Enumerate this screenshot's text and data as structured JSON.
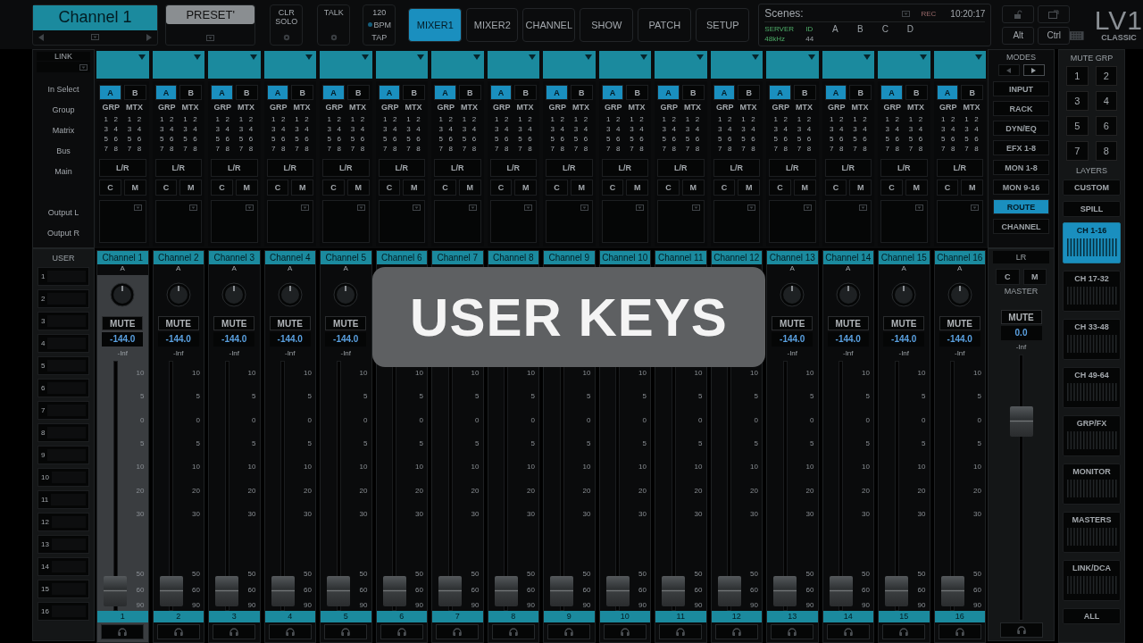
{
  "top_bar": {
    "channel_name": "Channel 1",
    "preset": "PRESET'",
    "clr_solo": "CLR SOLO",
    "talk": "TALK",
    "bpm": "120",
    "bpm_unit": "BPM",
    "tap": "TAP",
    "tabs": [
      {
        "label": "MIXER1",
        "selected": true
      },
      {
        "label": "MIXER2",
        "selected": false
      },
      {
        "label": "CHANNEL",
        "selected": false
      },
      {
        "label": "SHOW",
        "selected": false
      },
      {
        "label": "PATCH",
        "selected": false
      },
      {
        "label": "SETUP",
        "selected": false
      }
    ],
    "scenes": {
      "label": "Scenes:",
      "rec": "REC",
      "time": "10:20:17",
      "server": "SERVER",
      "server_id": "ID",
      "rate": "48kHz",
      "slots": [
        "A",
        "B",
        "C",
        "D"
      ],
      "slot_value": "44"
    },
    "alt": "Alt",
    "ctrl": "Ctrl",
    "logo": "LV1",
    "logo_sub": "CLASSIC"
  },
  "link": "LINK",
  "routing_labels": [
    "In Select",
    "Group",
    "Matrix",
    "Bus",
    "Main",
    "Output L",
    "Output R"
  ],
  "user": {
    "title": "USER",
    "keys": [
      "1",
      "2",
      "3",
      "4",
      "5",
      "6",
      "7",
      "8",
      "9",
      "10",
      "11",
      "12",
      "13",
      "14",
      "15",
      "16"
    ]
  },
  "channels": [
    {
      "name": "Channel 1",
      "selected": true,
      "in_select": [
        {
          "label": "A",
          "selected": true
        },
        {
          "label": "B",
          "selected": false
        }
      ],
      "grp": "GRP",
      "mtx": "MTX",
      "grp_keys": [
        "1",
        "2",
        "3",
        "4",
        "5",
        "6",
        "7",
        "8"
      ],
      "mtx_keys": [
        "1",
        "2",
        "3",
        "4",
        "5",
        "6",
        "7",
        "8"
      ],
      "main": "L/R",
      "c": "C",
      "m": "M",
      "input": "A",
      "mute": "MUTE",
      "gain": "-144.0",
      "meter": "-Inf",
      "scale": [
        "10",
        "5",
        "0",
        "5",
        "10",
        "20",
        "30",
        "50",
        "60",
        "90"
      ],
      "level": 0.02,
      "number": "1"
    },
    {
      "name": "Channel 2",
      "selected": false,
      "in_select": [
        {
          "label": "A",
          "selected": true
        },
        {
          "label": "B",
          "selected": false
        }
      ],
      "grp": "GRP",
      "mtx": "MTX",
      "grp_keys": [
        "1",
        "2",
        "3",
        "4",
        "5",
        "6",
        "7",
        "8"
      ],
      "mtx_keys": [
        "1",
        "2",
        "3",
        "4",
        "5",
        "6",
        "7",
        "8"
      ],
      "main": "L/R",
      "c": "C",
      "m": "M",
      "input": "A",
      "mute": "MUTE",
      "gain": "-144.0",
      "meter": "-Inf",
      "scale": [
        "10",
        "5",
        "0",
        "5",
        "10",
        "20",
        "30",
        "50",
        "60",
        "90"
      ],
      "level": 0.02,
      "number": "2"
    },
    {
      "name": "Channel 3",
      "selected": false,
      "in_select": [
        {
          "label": "A",
          "selected": true
        },
        {
          "label": "B",
          "selected": false
        }
      ],
      "grp": "GRP",
      "mtx": "MTX",
      "grp_keys": [
        "1",
        "2",
        "3",
        "4",
        "5",
        "6",
        "7",
        "8"
      ],
      "mtx_keys": [
        "1",
        "2",
        "3",
        "4",
        "5",
        "6",
        "7",
        "8"
      ],
      "main": "L/R",
      "c": "C",
      "m": "M",
      "input": "A",
      "mute": "MUTE",
      "gain": "-144.0",
      "meter": "-Inf",
      "scale": [
        "10",
        "5",
        "0",
        "5",
        "10",
        "20",
        "30",
        "50",
        "60",
        "90"
      ],
      "level": 0.02,
      "number": "3"
    },
    {
      "name": "Channel 4",
      "selected": false,
      "in_select": [
        {
          "label": "A",
          "selected": true
        },
        {
          "label": "B",
          "selected": false
        }
      ],
      "grp": "GRP",
      "mtx": "MTX",
      "grp_keys": [
        "1",
        "2",
        "3",
        "4",
        "5",
        "6",
        "7",
        "8"
      ],
      "mtx_keys": [
        "1",
        "2",
        "3",
        "4",
        "5",
        "6",
        "7",
        "8"
      ],
      "main": "L/R",
      "c": "C",
      "m": "M",
      "input": "A",
      "mute": "MUTE",
      "gain": "-144.0",
      "meter": "-Inf",
      "scale": [
        "10",
        "5",
        "0",
        "5",
        "10",
        "20",
        "30",
        "50",
        "60",
        "90"
      ],
      "level": 0.02,
      "number": "4"
    },
    {
      "name": "Channel 5",
      "selected": false,
      "in_select": [
        {
          "label": "A",
          "selected": true
        },
        {
          "label": "B",
          "selected": false
        }
      ],
      "grp": "GRP",
      "mtx": "MTX",
      "grp_keys": [
        "1",
        "2",
        "3",
        "4",
        "5",
        "6",
        "7",
        "8"
      ],
      "mtx_keys": [
        "1",
        "2",
        "3",
        "4",
        "5",
        "6",
        "7",
        "8"
      ],
      "main": "L/R",
      "c": "C",
      "m": "M",
      "input": "A",
      "mute": "MUTE",
      "gain": "-144.0",
      "meter": "-Inf",
      "scale": [
        "10",
        "5",
        "0",
        "5",
        "10",
        "20",
        "30",
        "50",
        "60",
        "90"
      ],
      "level": 0.02,
      "number": "5"
    },
    {
      "name": "Channel 6",
      "selected": false,
      "in_select": [
        {
          "label": "A",
          "selected": true
        },
        {
          "label": "B",
          "selected": false
        }
      ],
      "grp": "GRP",
      "mtx": "MTX",
      "grp_keys": [
        "1",
        "2",
        "3",
        "4",
        "5",
        "6",
        "7",
        "8"
      ],
      "mtx_keys": [
        "1",
        "2",
        "3",
        "4",
        "5",
        "6",
        "7",
        "8"
      ],
      "main": "L/R",
      "c": "C",
      "m": "M",
      "scale": [
        "10",
        "5",
        "0",
        "5",
        "10",
        "20",
        "30",
        "50",
        "60",
        "90"
      ],
      "level": 0.02,
      "number": "6"
    },
    {
      "name": "Channel 7",
      "selected": false,
      "in_select": [
        {
          "label": "A",
          "selected": true
        },
        {
          "label": "B",
          "selected": false
        }
      ],
      "grp": "GRP",
      "mtx": "MTX",
      "grp_keys": [
        "1",
        "2",
        "3",
        "4",
        "5",
        "6",
        "7",
        "8"
      ],
      "mtx_keys": [
        "1",
        "2",
        "3",
        "4",
        "5",
        "6",
        "7",
        "8"
      ],
      "main": "L/R",
      "c": "C",
      "m": "M",
      "scale": [
        "10",
        "5",
        "0",
        "5",
        "10",
        "20",
        "30",
        "50",
        "60",
        "90"
      ],
      "level": 0.02,
      "number": "7"
    },
    {
      "name": "Channel 8",
      "selected": false,
      "in_select": [
        {
          "label": "A",
          "selected": true
        },
        {
          "label": "B",
          "selected": false
        }
      ],
      "grp": "GRP",
      "mtx": "MTX",
      "grp_keys": [
        "1",
        "2",
        "3",
        "4",
        "5",
        "6",
        "7",
        "8"
      ],
      "mtx_keys": [
        "1",
        "2",
        "3",
        "4",
        "5",
        "6",
        "7",
        "8"
      ],
      "main": "L/R",
      "c": "C",
      "m": "M",
      "scale": [
        "10",
        "5",
        "0",
        "5",
        "10",
        "20",
        "30",
        "50",
        "60",
        "90"
      ],
      "level": 0.02,
      "number": "8"
    },
    {
      "name": "Channel 9",
      "selected": false,
      "in_select": [
        {
          "label": "A",
          "selected": true
        },
        {
          "label": "B",
          "selected": false
        }
      ],
      "grp": "GRP",
      "mtx": "MTX",
      "grp_keys": [
        "1",
        "2",
        "3",
        "4",
        "5",
        "6",
        "7",
        "8"
      ],
      "mtx_keys": [
        "1",
        "2",
        "3",
        "4",
        "5",
        "6",
        "7",
        "8"
      ],
      "main": "L/R",
      "c": "C",
      "m": "M",
      "scale": [
        "10",
        "5",
        "0",
        "5",
        "10",
        "20",
        "30",
        "50",
        "60",
        "90"
      ],
      "level": 0.02,
      "number": "9"
    },
    {
      "name": "Channel 10",
      "selected": false,
      "in_select": [
        {
          "label": "A",
          "selected": true
        },
        {
          "label": "B",
          "selected": false
        }
      ],
      "grp": "GRP",
      "mtx": "MTX",
      "grp_keys": [
        "1",
        "2",
        "3",
        "4",
        "5",
        "6",
        "7",
        "8"
      ],
      "mtx_keys": [
        "1",
        "2",
        "3",
        "4",
        "5",
        "6",
        "7",
        "8"
      ],
      "main": "L/R",
      "c": "C",
      "m": "M",
      "scale": [
        "10",
        "5",
        "0",
        "5",
        "10",
        "20",
        "30",
        "50",
        "60",
        "90"
      ],
      "level": 0.02,
      "number": "10"
    },
    {
      "name": "Channel 11",
      "selected": false,
      "in_select": [
        {
          "label": "A",
          "selected": true
        },
        {
          "label": "B",
          "selected": false
        }
      ],
      "grp": "GRP",
      "mtx": "MTX",
      "grp_keys": [
        "1",
        "2",
        "3",
        "4",
        "5",
        "6",
        "7",
        "8"
      ],
      "mtx_keys": [
        "1",
        "2",
        "3",
        "4",
        "5",
        "6",
        "7",
        "8"
      ],
      "main": "L/R",
      "c": "C",
      "m": "M",
      "scale": [
        "10",
        "5",
        "0",
        "5",
        "10",
        "20",
        "30",
        "50",
        "60",
        "90"
      ],
      "level": 0.02,
      "number": "11"
    },
    {
      "name": "Channel 12",
      "selected": false,
      "in_select": [
        {
          "label": "A",
          "selected": true
        },
        {
          "label": "B",
          "selected": false
        }
      ],
      "grp": "GRP",
      "mtx": "MTX",
      "grp_keys": [
        "1",
        "2",
        "3",
        "4",
        "5",
        "6",
        "7",
        "8"
      ],
      "mtx_keys": [
        "1",
        "2",
        "3",
        "4",
        "5",
        "6",
        "7",
        "8"
      ],
      "main": "L/R",
      "c": "C",
      "m": "M",
      "scale": [
        "10",
        "5",
        "0",
        "5",
        "10",
        "20",
        "30",
        "50",
        "60",
        "90"
      ],
      "level": 0.02,
      "number": "12"
    },
    {
      "name": "Channel 13",
      "selected": false,
      "in_select": [
        {
          "label": "A",
          "selected": true
        },
        {
          "label": "B",
          "selected": false
        }
      ],
      "grp": "GRP",
      "mtx": "MTX",
      "grp_keys": [
        "1",
        "2",
        "3",
        "4",
        "5",
        "6",
        "7",
        "8"
      ],
      "mtx_keys": [
        "1",
        "2",
        "3",
        "4",
        "5",
        "6",
        "7",
        "8"
      ],
      "main": "L/R",
      "c": "C",
      "m": "M",
      "input": "A",
      "mute": "MUTE",
      "gain": "-144.0",
      "meter": "-Inf",
      "scale": [
        "10",
        "5",
        "0",
        "5",
        "10",
        "20",
        "30",
        "50",
        "60",
        "90"
      ],
      "level": 0.02,
      "number": "13"
    },
    {
      "name": "Channel 14",
      "selected": false,
      "in_select": [
        {
          "label": "A",
          "selected": true
        },
        {
          "label": "B",
          "selected": false
        }
      ],
      "grp": "GRP",
      "mtx": "MTX",
      "grp_keys": [
        "1",
        "2",
        "3",
        "4",
        "5",
        "6",
        "7",
        "8"
      ],
      "mtx_keys": [
        "1",
        "2",
        "3",
        "4",
        "5",
        "6",
        "7",
        "8"
      ],
      "main": "L/R",
      "c": "C",
      "m": "M",
      "input": "A",
      "mute": "MUTE",
      "gain": "-144.0",
      "meter": "-Inf",
      "scale": [
        "10",
        "5",
        "0",
        "5",
        "10",
        "20",
        "30",
        "50",
        "60",
        "90"
      ],
      "level": 0.02,
      "number": "14"
    },
    {
      "name": "Channel 15",
      "selected": false,
      "in_select": [
        {
          "label": "A",
          "selected": true
        },
        {
          "label": "B",
          "selected": false
        }
      ],
      "grp": "GRP",
      "mtx": "MTX",
      "grp_keys": [
        "1",
        "2",
        "3",
        "4",
        "5",
        "6",
        "7",
        "8"
      ],
      "mtx_keys": [
        "1",
        "2",
        "3",
        "4",
        "5",
        "6",
        "7",
        "8"
      ],
      "main": "L/R",
      "c": "C",
      "m": "M",
      "input": "A",
      "mute": "MUTE",
      "gain": "-144.0",
      "meter": "-Inf",
      "scale": [
        "10",
        "5",
        "0",
        "5",
        "10",
        "20",
        "30",
        "50",
        "60",
        "90"
      ],
      "level": 0.02,
      "number": "15"
    },
    {
      "name": "Channel 16",
      "selected": false,
      "in_select": [
        {
          "label": "A",
          "selected": true
        },
        {
          "label": "B",
          "selected": false
        }
      ],
      "grp": "GRP",
      "mtx": "MTX",
      "grp_keys": [
        "1",
        "2",
        "3",
        "4",
        "5",
        "6",
        "7",
        "8"
      ],
      "mtx_keys": [
        "1",
        "2",
        "3",
        "4",
        "5",
        "6",
        "7",
        "8"
      ],
      "main": "L/R",
      "c": "C",
      "m": "M",
      "input": "A",
      "mute": "MUTE",
      "gain": "-144.0",
      "meter": "-Inf",
      "scale": [
        "10",
        "5",
        "0",
        "5",
        "10",
        "20",
        "30",
        "50",
        "60",
        "90"
      ],
      "level": 0.02,
      "number": "16"
    }
  ],
  "modes": {
    "title": "MODES",
    "items": [
      {
        "label": "INPUT",
        "selected": false
      },
      {
        "label": "RACK",
        "selected": false
      },
      {
        "label": "DYN/EQ",
        "selected": false
      },
      {
        "label": "EFX 1-8",
        "selected": false
      },
      {
        "label": "MON 1-8",
        "selected": false
      },
      {
        "label": "MON 9-16",
        "selected": false
      },
      {
        "label": "ROUTE",
        "selected": true
      },
      {
        "label": "CHANNEL",
        "selected": false
      }
    ]
  },
  "master": {
    "lr": "LR",
    "c": "C",
    "m": "M",
    "label": "MASTER",
    "mute": "MUTE",
    "gain": "0.0",
    "meter": "-Inf",
    "level": 0.78
  },
  "mute_groups": {
    "title": "MUTE GRP",
    "keys": [
      "1",
      "2",
      "3",
      "4",
      "5",
      "6",
      "7",
      "8"
    ]
  },
  "layers": {
    "title": "LAYERS",
    "items": [
      {
        "label": "CUSTOM",
        "kind": "plain",
        "selected": false
      },
      {
        "label": "SPILL",
        "kind": "plain",
        "selected": false
      },
      {
        "label": "CH 1-16",
        "kind": "bank",
        "selected": true
      },
      {
        "label": "CH 17-32",
        "kind": "bank",
        "selected": false
      },
      {
        "label": "CH 33-48",
        "kind": "bank",
        "selected": false
      },
      {
        "label": "CH 49-64",
        "kind": "bank",
        "selected": false
      },
      {
        "label": "GRP/FX",
        "kind": "bank",
        "selected": false
      },
      {
        "label": "MONITOR",
        "kind": "bank",
        "selected": false
      },
      {
        "label": "MASTERS",
        "kind": "bank",
        "selected": false
      },
      {
        "label": "LINK/DCA",
        "kind": "bank",
        "selected": false
      },
      {
        "label": "ALL",
        "kind": "plain",
        "selected": false
      }
    ]
  },
  "overlay": {
    "title": "USER KEYS"
  }
}
